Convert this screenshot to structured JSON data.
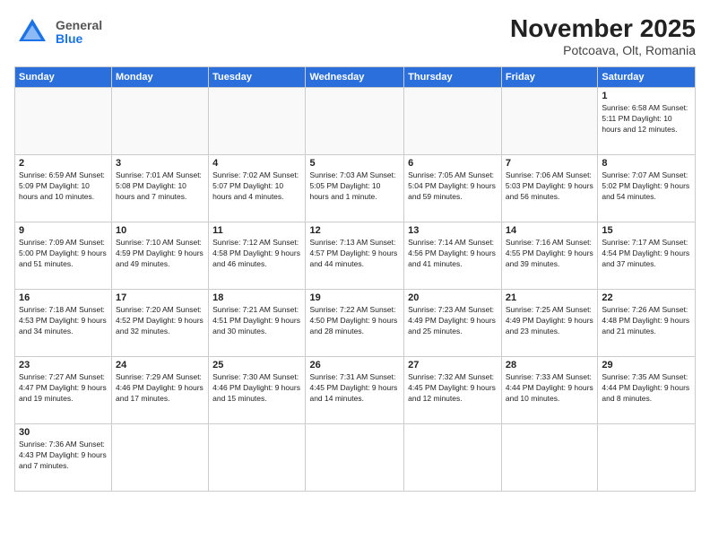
{
  "logo": {
    "general": "General",
    "blue": "Blue"
  },
  "header": {
    "month": "November 2025",
    "location": "Potcoava, Olt, Romania"
  },
  "days": [
    "Sunday",
    "Monday",
    "Tuesday",
    "Wednesday",
    "Thursday",
    "Friday",
    "Saturday"
  ],
  "weeks": [
    [
      {
        "date": "",
        "info": ""
      },
      {
        "date": "",
        "info": ""
      },
      {
        "date": "",
        "info": ""
      },
      {
        "date": "",
        "info": ""
      },
      {
        "date": "",
        "info": ""
      },
      {
        "date": "",
        "info": ""
      },
      {
        "date": "1",
        "info": "Sunrise: 6:58 AM\nSunset: 5:11 PM\nDaylight: 10 hours\nand 12 minutes."
      }
    ],
    [
      {
        "date": "2",
        "info": "Sunrise: 6:59 AM\nSunset: 5:09 PM\nDaylight: 10 hours\nand 10 minutes."
      },
      {
        "date": "3",
        "info": "Sunrise: 7:01 AM\nSunset: 5:08 PM\nDaylight: 10 hours\nand 7 minutes."
      },
      {
        "date": "4",
        "info": "Sunrise: 7:02 AM\nSunset: 5:07 PM\nDaylight: 10 hours\nand 4 minutes."
      },
      {
        "date": "5",
        "info": "Sunrise: 7:03 AM\nSunset: 5:05 PM\nDaylight: 10 hours\nand 1 minute."
      },
      {
        "date": "6",
        "info": "Sunrise: 7:05 AM\nSunset: 5:04 PM\nDaylight: 9 hours\nand 59 minutes."
      },
      {
        "date": "7",
        "info": "Sunrise: 7:06 AM\nSunset: 5:03 PM\nDaylight: 9 hours\nand 56 minutes."
      },
      {
        "date": "8",
        "info": "Sunrise: 7:07 AM\nSunset: 5:02 PM\nDaylight: 9 hours\nand 54 minutes."
      }
    ],
    [
      {
        "date": "9",
        "info": "Sunrise: 7:09 AM\nSunset: 5:00 PM\nDaylight: 9 hours\nand 51 minutes."
      },
      {
        "date": "10",
        "info": "Sunrise: 7:10 AM\nSunset: 4:59 PM\nDaylight: 9 hours\nand 49 minutes."
      },
      {
        "date": "11",
        "info": "Sunrise: 7:12 AM\nSunset: 4:58 PM\nDaylight: 9 hours\nand 46 minutes."
      },
      {
        "date": "12",
        "info": "Sunrise: 7:13 AM\nSunset: 4:57 PM\nDaylight: 9 hours\nand 44 minutes."
      },
      {
        "date": "13",
        "info": "Sunrise: 7:14 AM\nSunset: 4:56 PM\nDaylight: 9 hours\nand 41 minutes."
      },
      {
        "date": "14",
        "info": "Sunrise: 7:16 AM\nSunset: 4:55 PM\nDaylight: 9 hours\nand 39 minutes."
      },
      {
        "date": "15",
        "info": "Sunrise: 7:17 AM\nSunset: 4:54 PM\nDaylight: 9 hours\nand 37 minutes."
      }
    ],
    [
      {
        "date": "16",
        "info": "Sunrise: 7:18 AM\nSunset: 4:53 PM\nDaylight: 9 hours\nand 34 minutes."
      },
      {
        "date": "17",
        "info": "Sunrise: 7:20 AM\nSunset: 4:52 PM\nDaylight: 9 hours\nand 32 minutes."
      },
      {
        "date": "18",
        "info": "Sunrise: 7:21 AM\nSunset: 4:51 PM\nDaylight: 9 hours\nand 30 minutes."
      },
      {
        "date": "19",
        "info": "Sunrise: 7:22 AM\nSunset: 4:50 PM\nDaylight: 9 hours\nand 28 minutes."
      },
      {
        "date": "20",
        "info": "Sunrise: 7:23 AM\nSunset: 4:49 PM\nDaylight: 9 hours\nand 25 minutes."
      },
      {
        "date": "21",
        "info": "Sunrise: 7:25 AM\nSunset: 4:49 PM\nDaylight: 9 hours\nand 23 minutes."
      },
      {
        "date": "22",
        "info": "Sunrise: 7:26 AM\nSunset: 4:48 PM\nDaylight: 9 hours\nand 21 minutes."
      }
    ],
    [
      {
        "date": "23",
        "info": "Sunrise: 7:27 AM\nSunset: 4:47 PM\nDaylight: 9 hours\nand 19 minutes."
      },
      {
        "date": "24",
        "info": "Sunrise: 7:29 AM\nSunset: 4:46 PM\nDaylight: 9 hours\nand 17 minutes."
      },
      {
        "date": "25",
        "info": "Sunrise: 7:30 AM\nSunset: 4:46 PM\nDaylight: 9 hours\nand 15 minutes."
      },
      {
        "date": "26",
        "info": "Sunrise: 7:31 AM\nSunset: 4:45 PM\nDaylight: 9 hours\nand 14 minutes."
      },
      {
        "date": "27",
        "info": "Sunrise: 7:32 AM\nSunset: 4:45 PM\nDaylight: 9 hours\nand 12 minutes."
      },
      {
        "date": "28",
        "info": "Sunrise: 7:33 AM\nSunset: 4:44 PM\nDaylight: 9 hours\nand 10 minutes."
      },
      {
        "date": "29",
        "info": "Sunrise: 7:35 AM\nSunset: 4:44 PM\nDaylight: 9 hours\nand 8 minutes."
      }
    ],
    [
      {
        "date": "30",
        "info": "Sunrise: 7:36 AM\nSunset: 4:43 PM\nDaylight: 9 hours\nand 7 minutes."
      },
      {
        "date": "",
        "info": ""
      },
      {
        "date": "",
        "info": ""
      },
      {
        "date": "",
        "info": ""
      },
      {
        "date": "",
        "info": ""
      },
      {
        "date": "",
        "info": ""
      },
      {
        "date": "",
        "info": ""
      }
    ]
  ]
}
